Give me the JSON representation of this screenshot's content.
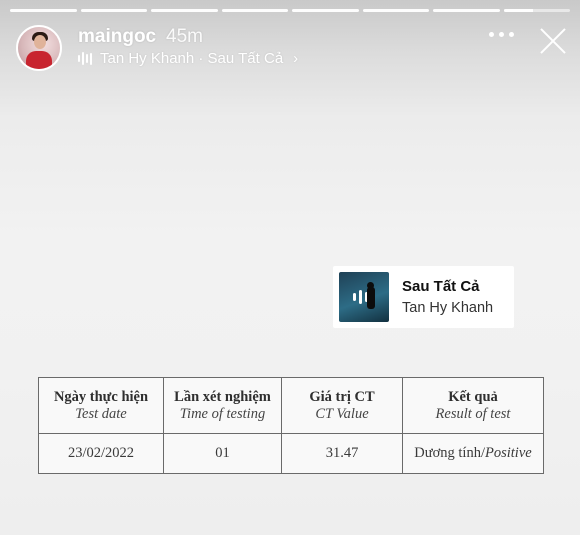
{
  "story": {
    "progress_segments": 8,
    "active_segment": 8,
    "active_progress": 0.45
  },
  "header": {
    "username": "maingoc",
    "timestamp": "45m",
    "music_label": "Tan Hy Khanh · Sau Tất Cả",
    "icons": {
      "music": "audio-bars-icon",
      "chevron": "chevron-right-icon",
      "more": "more-options-icon",
      "close": "close-icon"
    }
  },
  "music_sticker": {
    "title": "Sau Tất Cả",
    "artist": "Tan Hy Khanh"
  },
  "result_table": {
    "headers": [
      {
        "vi": "Ngày thực hiện",
        "en": "Test date"
      },
      {
        "vi": "Lần xét nghiệm",
        "en": "Time of testing"
      },
      {
        "vi": "Giá trị CT",
        "en": "CT Value"
      },
      {
        "vi": "Kết quả",
        "en": "Result of test"
      }
    ],
    "row": {
      "date": "23/02/2022",
      "time_of_testing": "01",
      "ct_value": "31.47",
      "result_vi": "Dương tính/",
      "result_en": "Positive"
    }
  },
  "colors": {
    "background": "#f1f1f1",
    "overlay_text": "#ffffff",
    "table_border": "#6a6a6a"
  }
}
